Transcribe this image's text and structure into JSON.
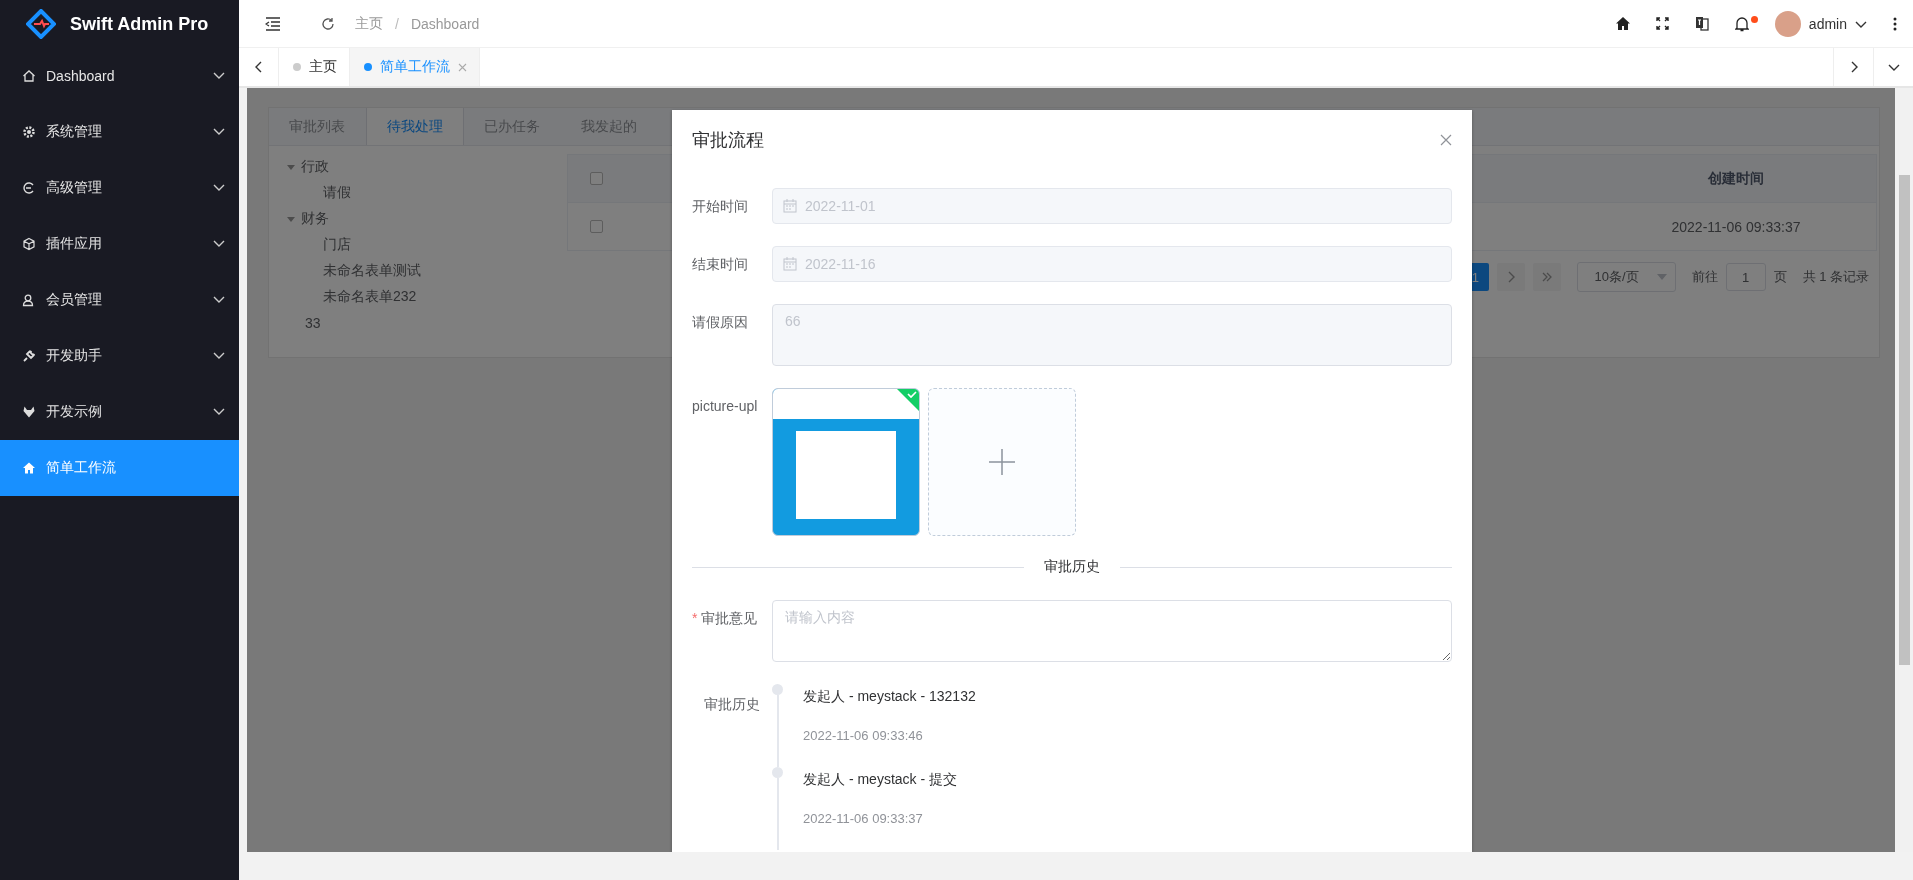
{
  "app": {
    "name": "Swift Admin Pro"
  },
  "sidebar": {
    "items": [
      {
        "label": "Dashboard",
        "selected": false,
        "has_children": true
      },
      {
        "label": "系统管理",
        "selected": false,
        "has_children": true
      },
      {
        "label": "高级管理",
        "selected": false,
        "has_children": true
      },
      {
        "label": "插件应用",
        "selected": false,
        "has_children": true
      },
      {
        "label": "会员管理",
        "selected": false,
        "has_children": true
      },
      {
        "label": "开发助手",
        "selected": false,
        "has_children": true
      },
      {
        "label": "开发示例",
        "selected": false,
        "has_children": true
      },
      {
        "label": "简单工作流",
        "selected": true,
        "has_children": false
      }
    ]
  },
  "header": {
    "breadcrumb": [
      "主页",
      "Dashboard"
    ],
    "separator": "/",
    "notifications_unread": true,
    "user": "admin"
  },
  "tabs": [
    {
      "label": "主页",
      "selected": false,
      "closable": false
    },
    {
      "label": "简单工作流",
      "selected": true,
      "closable": true
    }
  ],
  "content": {
    "tabs": [
      {
        "label": "审批列表",
        "selected": false
      },
      {
        "label": "待我处理",
        "selected": true
      },
      {
        "label": "已办任务",
        "selected": false
      },
      {
        "label": "我发起的",
        "selected": false
      }
    ],
    "tree": [
      {
        "label": "行政",
        "expanded": true,
        "children": [
          {
            "label": "请假"
          }
        ]
      },
      {
        "label": "财务",
        "expanded": true,
        "children": [
          {
            "label": "门店"
          },
          {
            "label": "未命名表单测试"
          },
          {
            "label": "未命名表单232"
          }
        ]
      },
      {
        "label": "33"
      }
    ],
    "table": {
      "header_checked": false,
      "columns": [
        "创建时间"
      ],
      "rows": [
        {
          "checked": false,
          "cells": [
            "2022-11-06 09:33:37"
          ]
        }
      ]
    },
    "pagination": {
      "pages": [
        {
          "label": "1",
          "selected": true
        }
      ],
      "page_size": "10条/页",
      "goto_label": "前往",
      "goto_value": "1",
      "page_unit": "页",
      "total": "共 1 条记录"
    }
  },
  "modal": {
    "title": "审批流程",
    "fields": [
      {
        "label": "开始时间",
        "kind": "date",
        "value": "2022-11-01",
        "disabled": true
      },
      {
        "label": "结束时间",
        "kind": "date",
        "value": "2022-11-16",
        "disabled": true
      },
      {
        "label": "请假原因",
        "kind": "textarea",
        "value": "66",
        "disabled": true
      },
      {
        "label": "picture-upl",
        "kind": "upload",
        "files": [
          {
            "uploaded": true
          }
        ]
      }
    ],
    "divider": "审批历史",
    "opinion": {
      "required_mark": "*",
      "label": "审批意见",
      "placeholder": "请输入内容"
    },
    "history": {
      "label": "审批历史",
      "items": [
        {
          "title": "发起人 - meystack - 132132",
          "time": "2022-11-06 09:33:46"
        },
        {
          "title": "发起人 - meystack - 提交",
          "time": "2022-11-06 09:33:37"
        }
      ]
    }
  }
}
